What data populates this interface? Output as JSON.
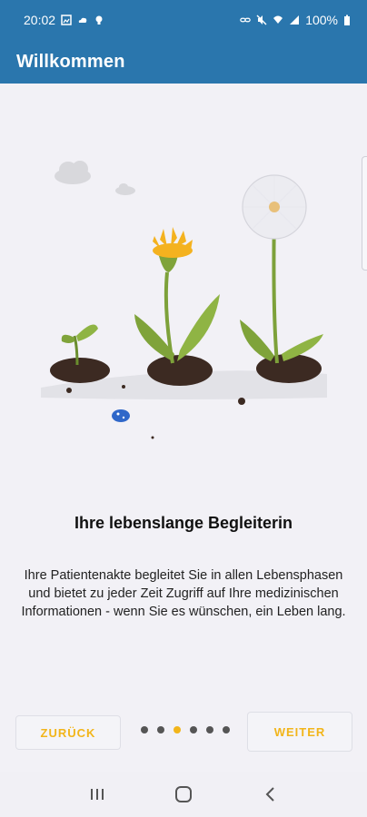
{
  "status_bar": {
    "time": "20:02",
    "battery": "100%"
  },
  "app_bar": {
    "title": "Willkommen"
  },
  "onboarding": {
    "headline": "Ihre lebenslange Begleiterin",
    "description": "Ihre Patientenakte begleitet Sie in allen Lebensphasen und bietet zu jeder Zeit Zugriff auf Ihre medizinischen Informationen - wenn Sie es wünschen, ein Leben lang.",
    "current_page": 3,
    "total_pages": 6
  },
  "buttons": {
    "back_label": "ZURÜCK",
    "next_label": "WEITER"
  },
  "colors": {
    "brand_blue": "#2a76ad",
    "accent_yellow": "#f2b51a"
  },
  "icons": {
    "status_left": [
      "gallery-icon",
      "cloud-icon",
      "lightbulb-icon"
    ],
    "status_right": [
      "link-icon",
      "mute-icon",
      "wifi-icon",
      "signal-icon",
      "battery-icon"
    ],
    "system_nav": [
      "recent-apps-icon",
      "home-icon",
      "back-icon"
    ]
  }
}
